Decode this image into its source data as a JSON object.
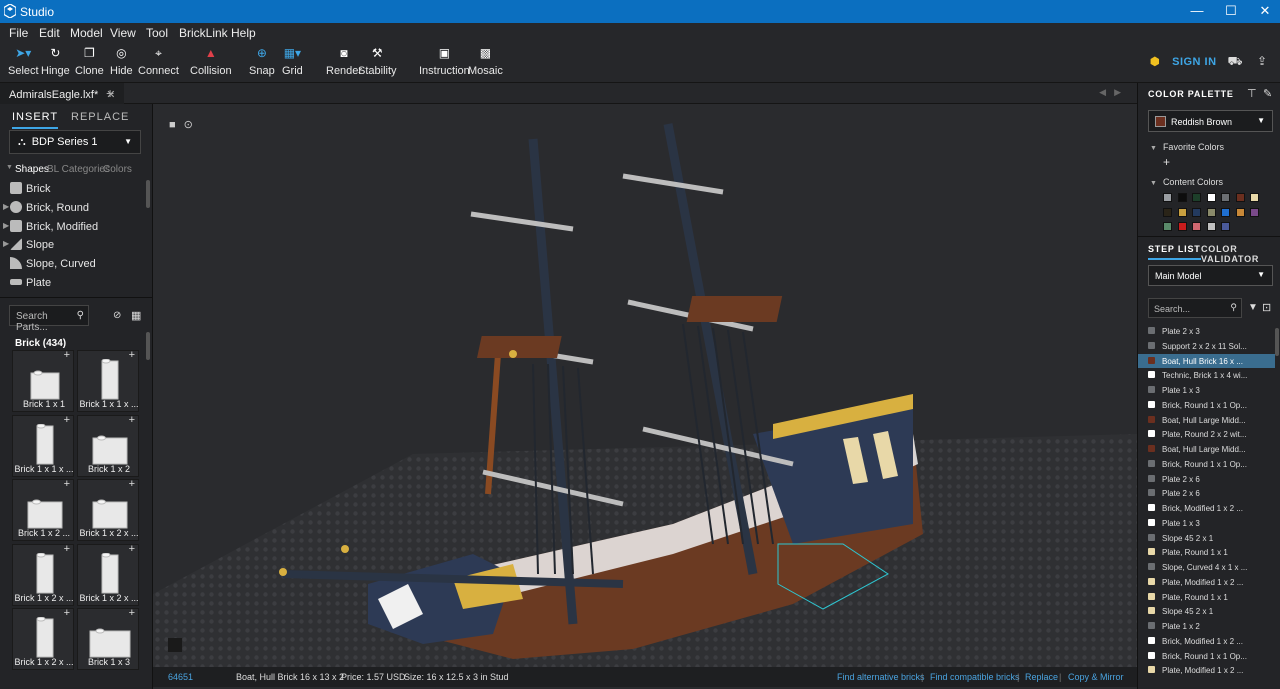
{
  "window": {
    "title": "Studio",
    "controls": [
      "—",
      "☐",
      "✕"
    ]
  },
  "menu": [
    "File",
    "Edit",
    "Model",
    "View",
    "Tool",
    "BrickLink",
    "Help"
  ],
  "toolbar": {
    "tools": [
      {
        "label": "Select",
        "icon": "cursor-icon"
      },
      {
        "label": "Hinge",
        "icon": "hinge-icon"
      },
      {
        "label": "Clone",
        "icon": "clone-icon"
      },
      {
        "label": "Hide",
        "icon": "hide-icon"
      },
      {
        "label": "Connect",
        "icon": "connect-icon"
      },
      {
        "label": "Collision",
        "icon": "collision-icon"
      },
      {
        "label": "Snap",
        "icon": "snap-icon"
      },
      {
        "label": "Grid",
        "icon": "grid-icon"
      },
      {
        "label": "Render",
        "icon": "camera-icon"
      },
      {
        "label": "Stability",
        "icon": "stability-icon"
      },
      {
        "label": "Instruction",
        "icon": "instruction-icon"
      },
      {
        "label": "Mosaic",
        "icon": "mosaic-icon"
      }
    ],
    "sign_in": "SIGN IN"
  },
  "document": {
    "tab": "AdmiralsEagle.lxf*"
  },
  "left": {
    "tab_insert": "INSERT",
    "tab_replace": "REPLACE",
    "series": "BDP Series 1",
    "subtabs": [
      "Shapes",
      "BL Categories",
      "Colors"
    ],
    "shapes": [
      "Brick",
      "Brick, Round",
      "Brick, Modified",
      "Slope",
      "Slope, Curved",
      "Plate"
    ],
    "search_placeholder": "Search Parts...",
    "category": "Brick (434)",
    "parts": [
      "Brick 1 x 1",
      "Brick 1 x 1 x ...",
      "Brick 1 x 1 x ...",
      "Brick 1 x 2",
      "Brick 1 x 2 ...",
      "Brick 1 x 2 x ...",
      "Brick 1 x 2 x ...",
      "Brick 1 x 2 x ...",
      "Brick 1 x 2 x ...",
      "Brick 1 x 3"
    ]
  },
  "status": {
    "part_id": "64651",
    "part_name": "Boat, Hull Brick 16 x 13 x 2",
    "price": "Price: 1.57 USD",
    "size": "Size: 16 x 12.5 x 3 in Stud",
    "links": [
      "Find alternative bricks",
      "Find compatible bricks",
      "Replace",
      "Copy & Mirror"
    ]
  },
  "right": {
    "color_palette": "COLOR PALETTE",
    "selected_color": "Reddish Brown",
    "favorite_colors": "Favorite Colors",
    "content_colors": "Content Colors",
    "swatches": [
      "#9a9ea3",
      "#0d0d0d",
      "#1d3f2a",
      "#ffffff",
      "#6b6e72",
      "#6b2f1f",
      "#e8d8a8",
      "#2a2418",
      "#c8a040",
      "#233a5e",
      "#8a8a6a",
      "#1f6fd0",
      "#c88838",
      "#7a4a8a",
      "#5a8a6a",
      "#c81c1c",
      "#d06870",
      "#c0c0c0",
      "#4a5a9a"
    ],
    "tab_steps": "STEP LIST",
    "tab_validator": "COLOR VALIDATOR",
    "model": "Main Model",
    "search_placeholder": "Search...",
    "steps": [
      {
        "t": "Plate 2 x 3",
        "c": "#6b6e72"
      },
      {
        "t": "Support 2 x 2 x 11 Sol...",
        "c": "#6b6e72"
      },
      {
        "t": "Boat, Hull Brick 16 x ...",
        "c": "#6b2f1f",
        "sel": true
      },
      {
        "t": "Technic, Brick 1 x 4 wi...",
        "c": "#ffffff"
      },
      {
        "t": "Plate 1 x 3",
        "c": "#6b6e72"
      },
      {
        "t": "Brick, Round 1 x 1 Op...",
        "c": "#ffffff"
      },
      {
        "t": "Boat, Hull Large Midd...",
        "c": "#6b2f1f"
      },
      {
        "t": "Plate, Round 2 x 2 wit...",
        "c": "#ffffff"
      },
      {
        "t": "Boat, Hull Large Midd...",
        "c": "#6b2f1f"
      },
      {
        "t": "Brick, Round 1 x 1 Op...",
        "c": "#6b6e72"
      },
      {
        "t": "Plate 2 x 6",
        "c": "#6b6e72"
      },
      {
        "t": "Plate 2 x 6",
        "c": "#6b6e72"
      },
      {
        "t": "Brick, Modified 1 x 2 ...",
        "c": "#ffffff"
      },
      {
        "t": "Plate 1 x 3",
        "c": "#ffffff"
      },
      {
        "t": "Slope 45 2 x 1",
        "c": "#6b6e72"
      },
      {
        "t": "Plate, Round 1 x 1",
        "c": "#e8d8a8"
      },
      {
        "t": "Slope, Curved 4 x 1 x ...",
        "c": "#6b6e72"
      },
      {
        "t": "Plate, Modified 1 x 2 ...",
        "c": "#e8d8a8"
      },
      {
        "t": "Plate, Round 1 x 1",
        "c": "#e8d8a8"
      },
      {
        "t": "Slope 45 2 x 1",
        "c": "#e8d8a8"
      },
      {
        "t": "Plate 1 x 2",
        "c": "#6b6e72"
      },
      {
        "t": "Brick, Modified 1 x 2 ...",
        "c": "#ffffff"
      },
      {
        "t": "Brick, Round 1 x 1 Op...",
        "c": "#ffffff"
      },
      {
        "t": "Plate, Modified 1 x 2 ...",
        "c": "#e8d8a8"
      }
    ]
  }
}
